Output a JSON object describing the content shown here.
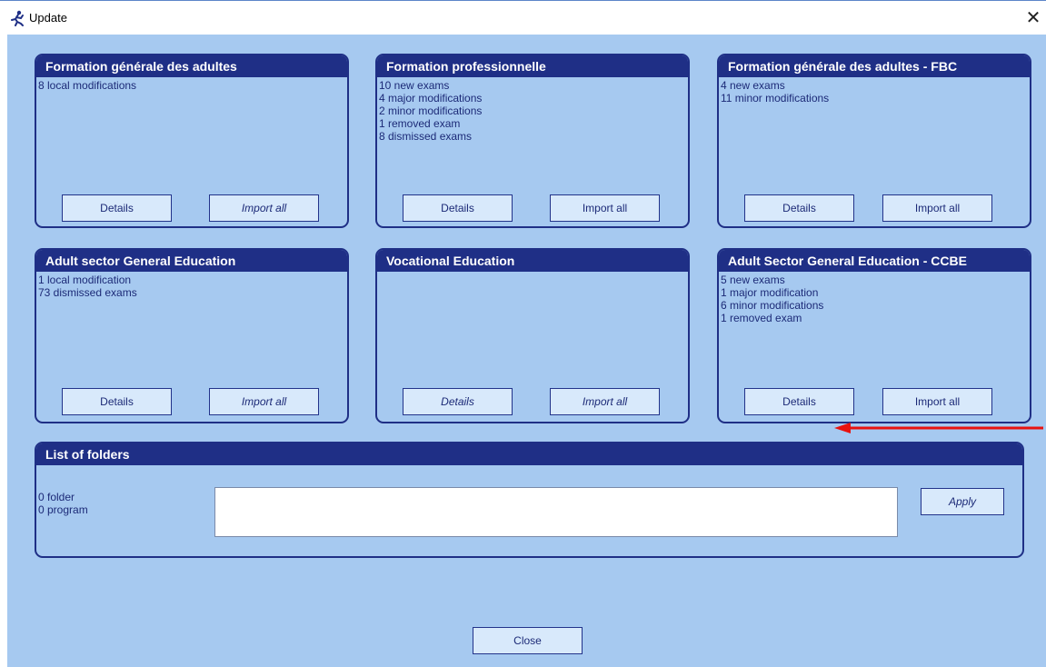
{
  "window": {
    "title": "Update",
    "close_glyph": "✕"
  },
  "panels": [
    {
      "title": "Formation générale des adultes",
      "lines": [
        "8 local modifications"
      ],
      "details_label": "Details",
      "details_enabled": true,
      "import_label": "Import all",
      "import_enabled": false
    },
    {
      "title": "Formation professionnelle",
      "lines": [
        "10 new exams",
        "4 major modifications",
        "2 minor modifications",
        "1 removed exam",
        "8 dismissed exams"
      ],
      "details_label": "Details",
      "details_enabled": true,
      "import_label": "Import all",
      "import_enabled": true
    },
    {
      "title": "Formation générale des adultes - FBC",
      "lines": [
        "4 new exams",
        "11 minor modifications"
      ],
      "details_label": "Details",
      "details_enabled": true,
      "import_label": "Import all",
      "import_enabled": true
    },
    {
      "title": "Adult sector General Education",
      "lines": [
        "1 local modification",
        "73 dismissed exams"
      ],
      "details_label": "Details",
      "details_enabled": true,
      "import_label": "Import all",
      "import_enabled": false
    },
    {
      "title": "Vocational Education",
      "lines": [],
      "details_label": "Details",
      "details_enabled": false,
      "import_label": "Import all",
      "import_enabled": false
    },
    {
      "title": "Adult Sector General Education - CCBE",
      "lines": [
        "5 new exams",
        "1 major modification",
        "6 minor modifications",
        "1 removed exam"
      ],
      "details_label": "Details",
      "details_enabled": true,
      "import_label": "Import all",
      "import_enabled": true
    }
  ],
  "folders": {
    "title": "List of folders",
    "folder_count": "0 folder",
    "program_count": "0 program",
    "input_value": "",
    "apply_label": "Apply"
  },
  "footer": {
    "close_label": "Close"
  },
  "colors": {
    "background": "#a6c9f0",
    "panel_header": "#1f2f86",
    "annotation_arrow": "#e8120f"
  }
}
